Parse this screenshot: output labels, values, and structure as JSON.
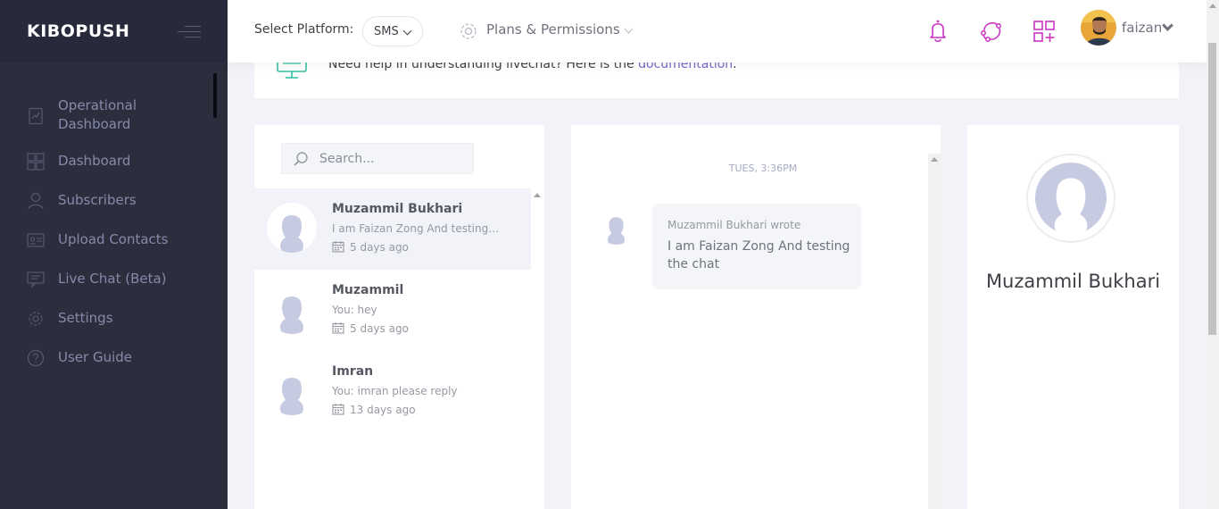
{
  "sidebar": {
    "brand": "KIBOPUSH",
    "items": [
      {
        "label_line1": "Operational",
        "label_line2": "Dashboard",
        "icon": "operational-dashboard-icon"
      },
      {
        "label": "Dashboard",
        "icon": "dashboard-grid-icon"
      },
      {
        "label": "Subscribers",
        "icon": "user-icon"
      },
      {
        "label": "Upload Contacts",
        "icon": "contact-card-icon"
      },
      {
        "label": "Live Chat (Beta)",
        "icon": "chat-monitor-icon"
      },
      {
        "label": "Settings",
        "icon": "gear-icon"
      },
      {
        "label": "User Guide",
        "icon": "help-icon"
      }
    ]
  },
  "topbar": {
    "platform_label": "Select Platform:",
    "platform_value": "SMS",
    "plans_label": "Plans & Permissions",
    "username": "faizan",
    "icons": [
      "notification-bell-icon",
      "share-network-icon",
      "apps-grid-icon"
    ],
    "accent_color": "#c934c2"
  },
  "help": {
    "text": "Need help in understanding livechat? Here is the ",
    "link": "documentation",
    "suffix": "."
  },
  "conversations": {
    "search_placeholder": "Search...",
    "items": [
      {
        "name": "Muzammil Bukhari",
        "message": "I am Faizan Zong And testing t...",
        "time": "5 days ago"
      },
      {
        "name": "Muzammil",
        "message": "You: hey",
        "time": "5 days ago"
      },
      {
        "name": "Imran",
        "message": "You: imran please reply",
        "time": "13 days ago"
      }
    ]
  },
  "chat": {
    "date": "TUES, 3:36PM",
    "author": "Muzammil Bukhari wrote",
    "text": "I am Faizan Zong And testing the chat"
  },
  "profile": {
    "name": "Muzammil Bukhari"
  }
}
